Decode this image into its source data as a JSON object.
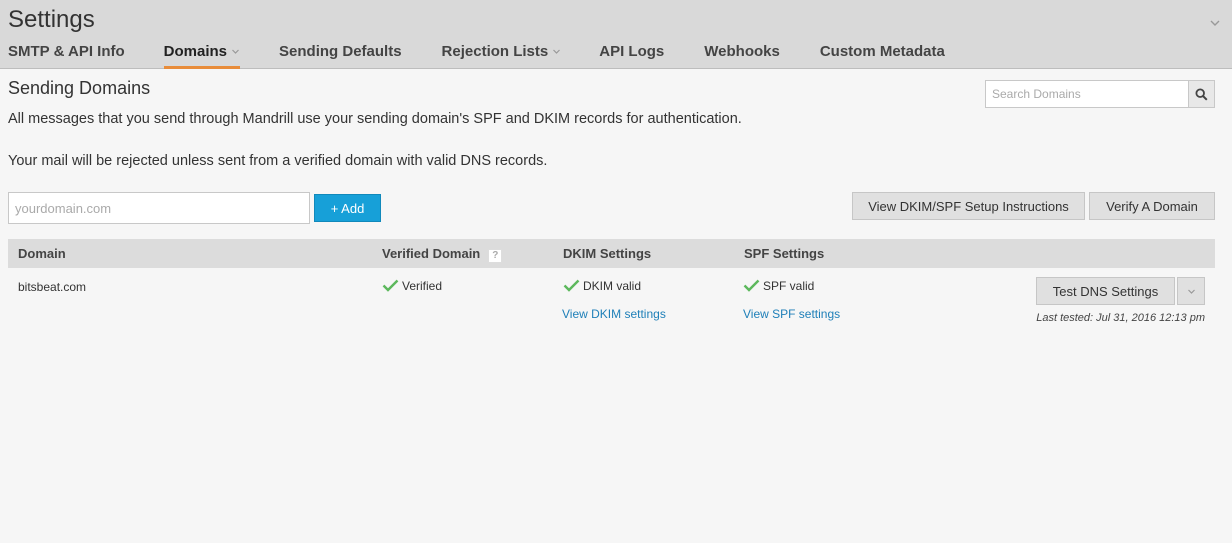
{
  "header": {
    "title": "Settings",
    "tabs": [
      {
        "label": "SMTP & API Info",
        "active": false,
        "has_caret": false
      },
      {
        "label": "Domains",
        "active": true,
        "has_caret": true
      },
      {
        "label": "Sending Defaults",
        "active": false,
        "has_caret": false
      },
      {
        "label": "Rejection Lists",
        "active": false,
        "has_caret": true
      },
      {
        "label": "API Logs",
        "active": false,
        "has_caret": false
      },
      {
        "label": "Webhooks",
        "active": false,
        "has_caret": false
      },
      {
        "label": "Custom Metadata",
        "active": false,
        "has_caret": false
      }
    ]
  },
  "main": {
    "section_title": "Sending Domains",
    "search": {
      "placeholder": "Search Domains",
      "value": "",
      "icon": "search-icon"
    },
    "description_1": "All messages that you send through Mandrill use your sending domain's SPF and DKIM records for authentication.",
    "description_2": "Your mail will be rejected unless sent from a verified domain with valid DNS records.",
    "add_domain": {
      "placeholder": "yourdomain.com",
      "value": "",
      "button_label": "+ Add"
    },
    "actions": {
      "dkim_instructions_label": "View DKIM/SPF Setup Instructions",
      "verify_label": "Verify A Domain"
    },
    "table": {
      "headers": {
        "domain": "Domain",
        "verified": "Verified Domain",
        "verified_help": "?",
        "dkim": "DKIM Settings",
        "spf": "SPF Settings"
      },
      "rows": [
        {
          "domain": "bitsbeat.com",
          "verified": "Verified",
          "dkim_status": "DKIM valid",
          "dkim_link": "View DKIM settings",
          "spf_status": "SPF valid",
          "spf_link": "View SPF settings",
          "test_button": "Test DNS Settings",
          "last_tested": "Last tested: Jul 31, 2016 12:13 pm"
        }
      ]
    }
  },
  "colors": {
    "accent": "#e88c3a",
    "primary_button": "#17a0d8",
    "link": "#1e7fb8",
    "check": "#5cb85c"
  }
}
